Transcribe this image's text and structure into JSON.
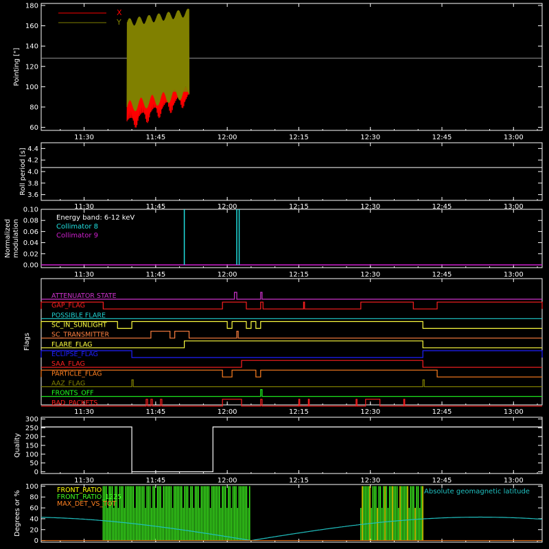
{
  "colors": {
    "background": "#000000",
    "axis": "#ffffff",
    "x_series": "#ff0000",
    "y_series": "#808000",
    "ref_line": "#9a9a9a",
    "attenuator": "#cc33cc",
    "gap": "#ff2020",
    "possible_flare": "#20d0d0",
    "sunlight": "#ffff40",
    "transmitter": "#ff8040",
    "flare": "#ffff40",
    "eclipse": "#2020ff",
    "saa": "#ff2020",
    "particle": "#ff8020",
    "aaz": "#808000",
    "fronts_off": "#20ff20",
    "bad_packets": "#ff2020",
    "collimator8": "#20e0e0",
    "collimator9": "#d020d0",
    "front_ratio": "#ffff00",
    "front_ratio_1225": "#40ff20",
    "max_det": "#ff8020",
    "latitude": "#20c0c0"
  },
  "time_ticks": [
    "11:30",
    "11:45",
    "12:00",
    "12:15",
    "12:30",
    "12:45",
    "13:00"
  ],
  "chart_data": [
    {
      "id": "pointing",
      "type": "line",
      "ylabel": "Pointing [\"]",
      "ylim": [
        57,
        182
      ],
      "yticks": [
        60,
        80,
        100,
        120,
        140,
        160,
        180
      ],
      "legend": [
        "X",
        "Y"
      ],
      "series": [
        {
          "name": "X",
          "t_start": "11:39",
          "t_end": "11:52",
          "min": 62,
          "max": 110
        },
        {
          "name": "Y",
          "t_start": "11:39",
          "t_end": "11:52",
          "min": 75,
          "max": 173
        }
      ],
      "reference_line": 128
    },
    {
      "id": "roll",
      "type": "line",
      "ylabel": "Roll period [s]",
      "ylim": [
        3.5,
        4.5
      ],
      "yticks": [
        "3.6",
        "3.8",
        "4.0",
        "4.2",
        "4.4"
      ],
      "value": 4.07
    },
    {
      "id": "modulation",
      "type": "line",
      "ylabel": "Normalized modulation",
      "ylabel_lines": [
        "Normalized",
        "modulation"
      ],
      "ylim": [
        -0.005,
        0.1
      ],
      "yticks": [
        "0.00",
        "0.02",
        "0.04",
        "0.06",
        "0.08",
        "0.10"
      ],
      "legend": [
        "Energy band: 6-12 keV",
        "Collimator 8",
        "Collimator 9"
      ],
      "spikes": [
        {
          "series": "Collimator 8",
          "t": "11:51"
        },
        {
          "series": "Collimator 8",
          "t": "12:02"
        },
        {
          "series": "Collimator 8",
          "t": "12:02.5"
        }
      ]
    },
    {
      "id": "flags",
      "type": "line",
      "ylabel": "Flags",
      "flags": [
        {
          "label": "ATTENUATOR STATE",
          "color": "attenuator",
          "on": [
            [
              "12:01.5",
              "12:02"
            ],
            [
              "12:07",
              "12:07.3"
            ]
          ]
        },
        {
          "label": "GAP_FLAG",
          "color": "gap",
          "on": [
            [
              "11:21",
              "11:34"
            ],
            [
              "11:59",
              "12:04"
            ],
            [
              "12:07",
              "12:07.5"
            ],
            [
              "12:16",
              "12:16.2"
            ],
            [
              "12:28",
              "12:39"
            ],
            [
              "12:44",
              "13:06"
            ]
          ]
        },
        {
          "label": "POSSIBLE FLARE",
          "color": "possible_flare",
          "on": []
        },
        {
          "label": "SC_IN_SUNLIGHT",
          "color": "sunlight",
          "on": [
            [
              "11:21",
              "11:37"
            ],
            [
              "11:40",
              "12:00"
            ],
            [
              "12:01",
              "12:04"
            ],
            [
              "12:05",
              "12:06"
            ],
            [
              "12:07",
              "12:41"
            ]
          ]
        },
        {
          "label": "SC_TRANSMITTER",
          "color": "transmitter",
          "on": [
            [
              "11:44",
              "11:48"
            ],
            [
              "11:49",
              "11:52"
            ],
            [
              "12:02",
              "12:02.3"
            ]
          ]
        },
        {
          "label": "FLARE_FLAG",
          "color": "flare",
          "on": [
            [
              "11:51",
              "12:41"
            ]
          ]
        },
        {
          "label": "ECLIPSE_FLAG",
          "color": "eclipse",
          "on": [
            [
              "11:21",
              "11:40"
            ],
            [
              "12:41",
              "13:06"
            ]
          ]
        },
        {
          "label": "SAA_FLAG",
          "color": "saa",
          "on": [
            [
              "12:03",
              "12:41"
            ]
          ]
        },
        {
          "label": "PARTICLE_FLAG",
          "color": "particle",
          "on": [
            [
              "11:21",
              "11:59"
            ],
            [
              "12:01",
              "12:06"
            ],
            [
              "12:07",
              "12:44"
            ]
          ]
        },
        {
          "label": "AAZ_FLAG",
          "color": "aaz",
          "on": [
            [
              "11:40",
              "11:40.3"
            ],
            [
              "12:41",
              "12:41.3"
            ]
          ]
        },
        {
          "label": "FRONTS_OFF",
          "color": "fronts_off",
          "on": [
            [
              "12:07",
              "12:07.3"
            ]
          ]
        },
        {
          "label": "BAD_PACKETS",
          "color": "bad_packets",
          "on": [
            [
              "11:43",
              "11:43.3"
            ],
            [
              "11:44",
              "11:44.3"
            ],
            [
              "11:46",
              "11:46.3"
            ],
            [
              "11:59",
              "12:03"
            ],
            [
              "12:07",
              "12:07.3"
            ],
            [
              "12:15",
              "12:15.2"
            ],
            [
              "12:17",
              "12:17.2"
            ],
            [
              "12:27",
              "12:27.2"
            ],
            [
              "12:29",
              "12:32"
            ],
            [
              "12:37",
              "12:37.2"
            ]
          ]
        }
      ]
    },
    {
      "id": "quality",
      "type": "line",
      "ylabel": "Quality",
      "ylim": [
        -10,
        310
      ],
      "yticks": [
        0,
        50,
        100,
        150,
        200,
        250,
        300
      ],
      "segments": [
        {
          "t_start": "11:21",
          "t_end": "11:40",
          "value": 255
        },
        {
          "t_start": "11:40",
          "t_end": "11:57",
          "value": 0
        },
        {
          "t_start": "11:57",
          "t_end": "13:06",
          "value": 255
        }
      ]
    },
    {
      "id": "ratios",
      "type": "line",
      "ylabel": "Degrees or %",
      "ylim": [
        -3,
        103
      ],
      "yticks": [
        0,
        20,
        40,
        60,
        80,
        100
      ],
      "legend": [
        "FRONT_RATIO",
        "FRONT_RATIO_1225",
        "MAX_DET_VS_TOT"
      ],
      "annotation": "Absolute geomagnetic latitude",
      "latitude_curve": {
        "amplitude": 43,
        "zeros": [
          "12:05",
          "12:53"
        ],
        "period_min": 96
      },
      "ratio_bursts": [
        [
          "11:34",
          "12:05"
        ],
        [
          "12:28",
          "12:41"
        ]
      ]
    }
  ]
}
